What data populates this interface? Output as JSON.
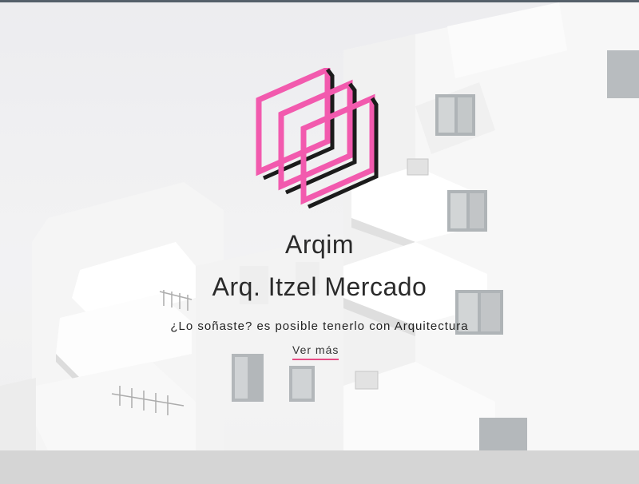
{
  "hero": {
    "brand_name": "Arqim",
    "owner_name": "Arq. Itzel Mercado",
    "tagline": "¿Lo soñaste? es posible tenerlo con Arquitectura",
    "cta_label": "Ver más"
  },
  "colors": {
    "accent_pink": "#f25aae",
    "accent_dark": "#1b1b1b",
    "cta_underline": "#e64c84"
  },
  "icons": [
    "arqim-logo-icon"
  ]
}
